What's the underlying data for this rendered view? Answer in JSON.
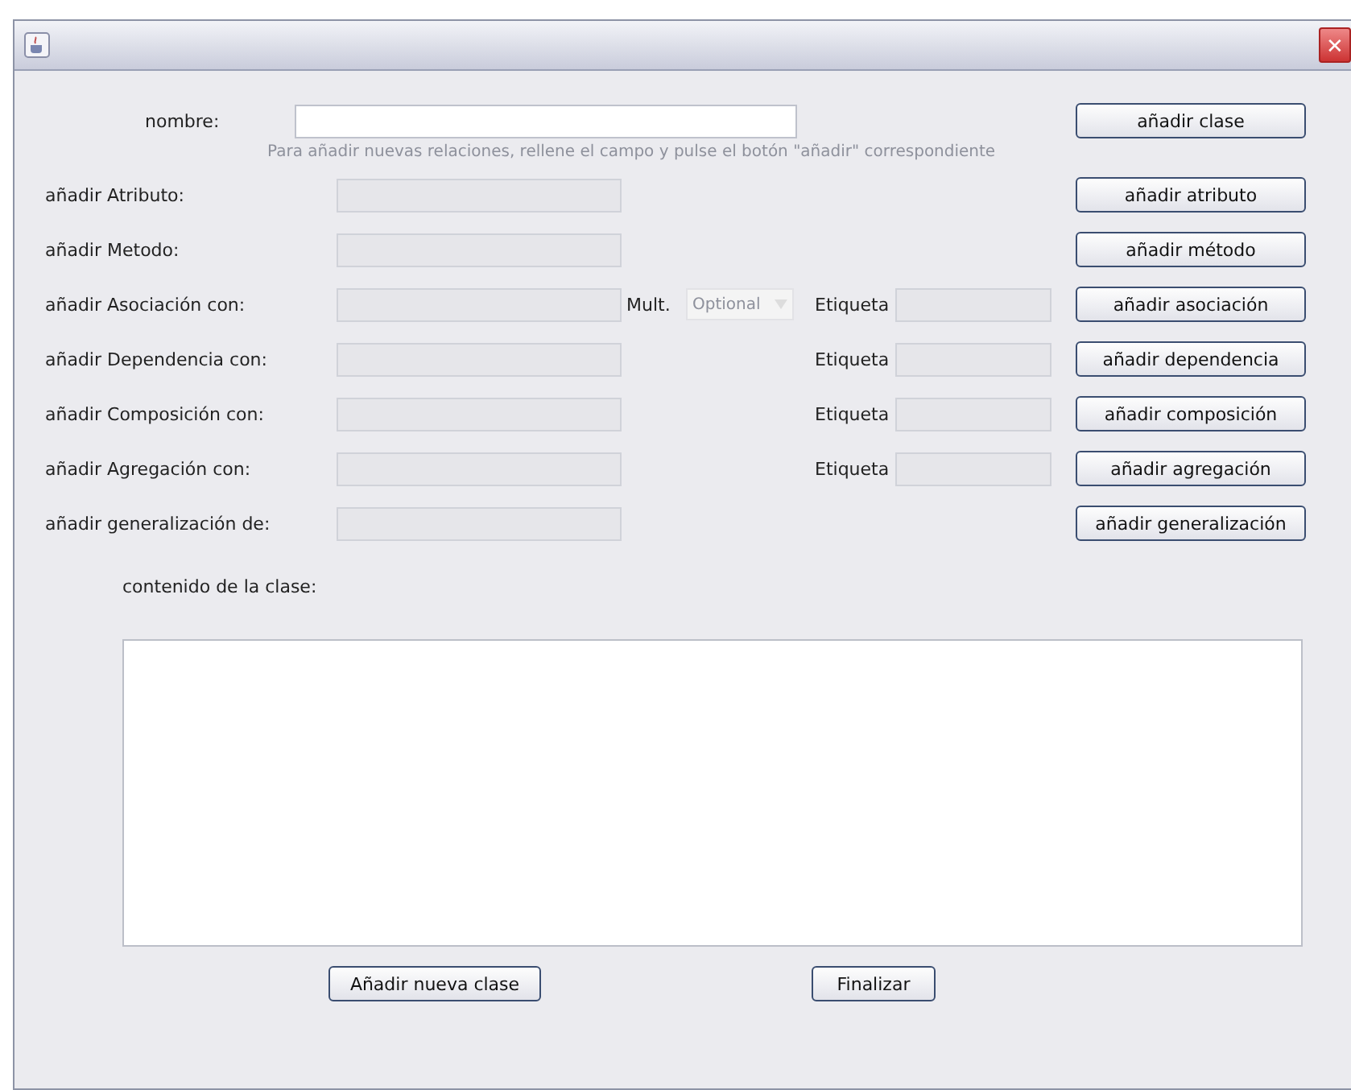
{
  "window": {
    "close": "✕"
  },
  "name_row": {
    "label": "nombre:",
    "field": {
      "disabled": false
    },
    "button": "añadir clase"
  },
  "hint": "Para añadir nuevas relaciones, rellene el campo y pulse el botón \"añadir\" correspondiente",
  "rows": [
    {
      "kind": "simple",
      "label": "añadir Atributo:",
      "disabled": true,
      "button": "añadir atributo"
    },
    {
      "kind": "simple",
      "label": "añadir Metodo:",
      "disabled": true,
      "button": "añadir método"
    },
    {
      "kind": "association",
      "label": "añadir Asociación con:",
      "disabled": true,
      "mult_label": "Mult.",
      "mult_value": "Optional",
      "tag_label": "Etiqueta",
      "button": "añadir asociación"
    },
    {
      "kind": "tagged",
      "label": "añadir Dependencia con:",
      "disabled": true,
      "tag_label": "Etiqueta",
      "button": "añadir dependencia"
    },
    {
      "kind": "tagged",
      "label": "añadir Composición con:",
      "disabled": true,
      "tag_label": "Etiqueta",
      "button": "añadir composición"
    },
    {
      "kind": "tagged",
      "label": "añadir Agregación con:",
      "disabled": true,
      "tag_label": "Etiqueta",
      "button": "añadir agregación"
    },
    {
      "kind": "simple",
      "label": "añadir generalización  de:",
      "disabled": true,
      "button": "añadir generalización"
    }
  ],
  "content": {
    "label": "contenido de la clase:"
  },
  "buttons": [
    "Añadir nueva clase",
    "Finalizar"
  ]
}
